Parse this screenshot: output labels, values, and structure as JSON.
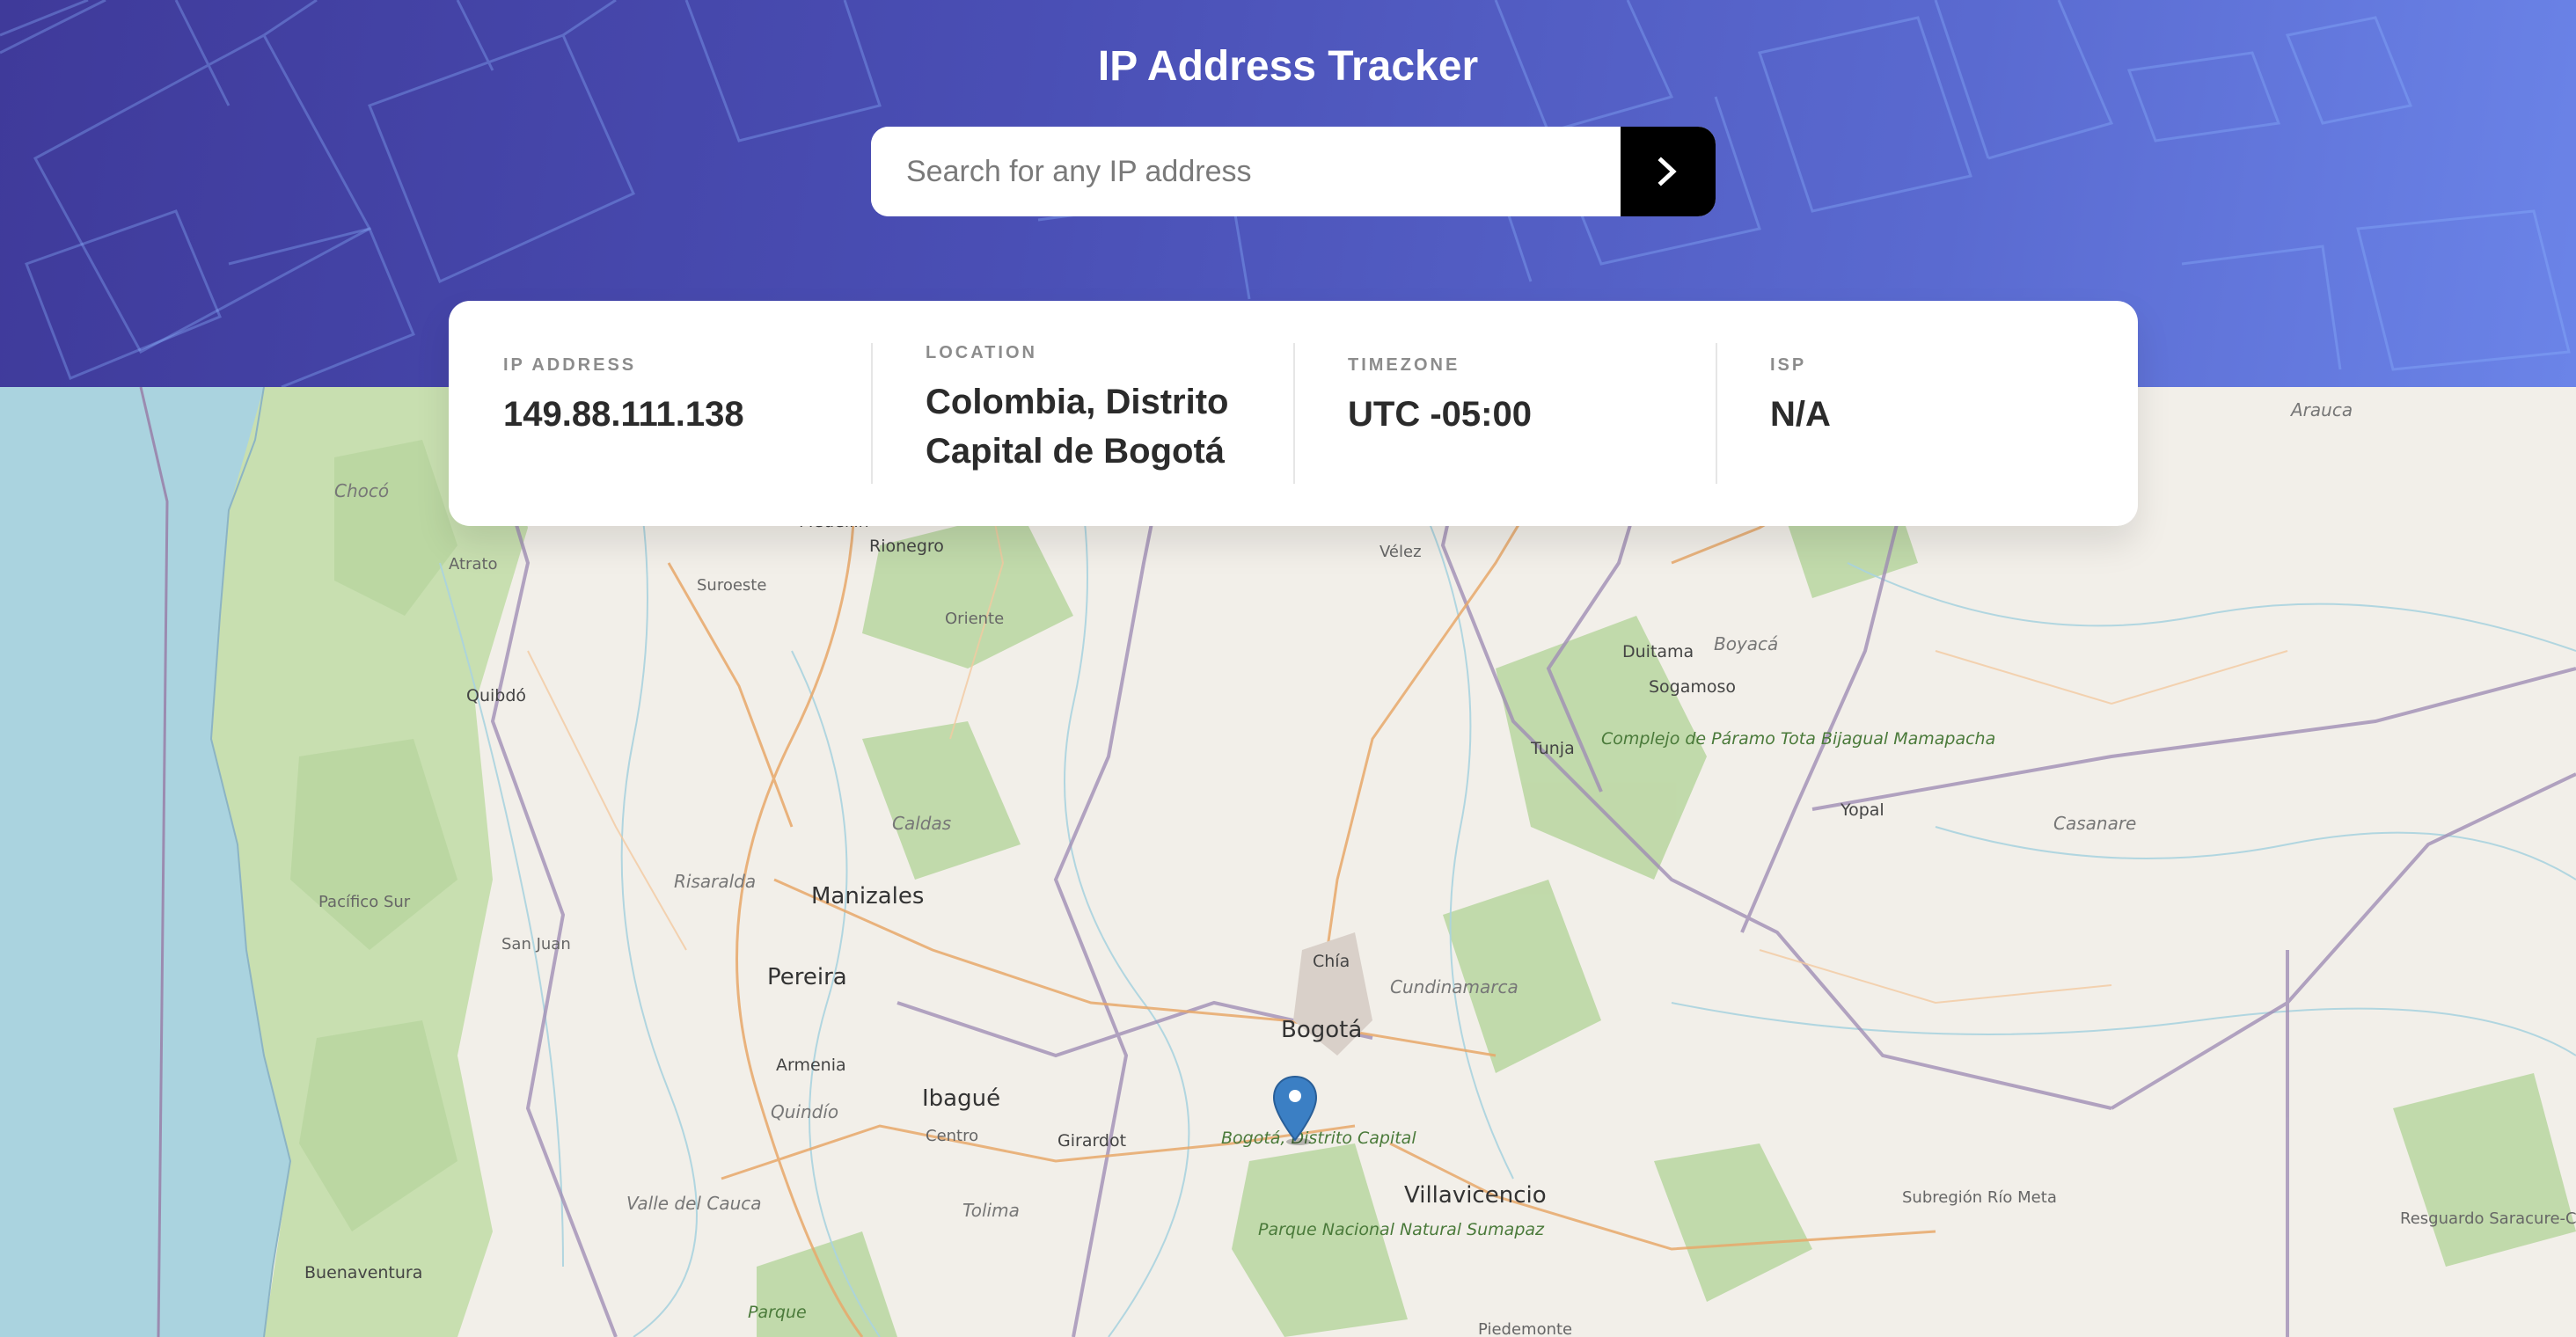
{
  "header": {
    "title": "IP Address Tracker",
    "search_placeholder": "Search for any IP address",
    "submit_icon": "chevron-right-icon"
  },
  "info": {
    "ip_label": "IP Address",
    "ip_value": "149.88.111.138",
    "location_label": "Location",
    "location_value": "Colombia, Distrito Capital de Bogotá",
    "timezone_label": "Timezone",
    "timezone_value": "UTC -05:00",
    "isp_label": "ISP",
    "isp_value": "N/A"
  },
  "map": {
    "marker_icon": "map-pin-icon",
    "labels": {
      "arauca": "Arauca",
      "choco": "Chocó",
      "medellin": "Medellín",
      "rionegro": "Rionegro",
      "velez": "Vélez",
      "atrato": "Atrato",
      "suroeste": "Suroeste",
      "oriente": "Oriente",
      "duitama": "Duitama",
      "boyaca": "Boyacá",
      "sogamoso": "Sogamoso",
      "quibdo": "Quibdó",
      "tunja": "Tunja",
      "complejo": "Complejo de Páramo Tota Bijagual Mamapacha",
      "yopal": "Yopal",
      "casanare": "Casanare",
      "caldas": "Caldas",
      "risaralda": "Risaralda",
      "manizales": "Manizales",
      "pacifico_sur": "Pacífico Sur",
      "san_juan": "San Juan",
      "chia": "Chía",
      "pereira": "Pereira",
      "cundinamarca": "Cundinamarca",
      "bogota": "Bogotá",
      "armenia": "Armenia",
      "ibague": "Ibagué",
      "quindio": "Quindío",
      "centro": "Centro",
      "girardot": "Girardot",
      "bogota_dc": "Bogotá, Distrito Capital",
      "villavicencio": "Villavicencio",
      "subregion": "Subregión Río Meta",
      "resguardo": "Resguardo Saracure-Cadá",
      "valle": "Valle del Cauca",
      "tolima": "Tolima",
      "parque_sumapaz": "Parque Nacional Natural Sumapaz",
      "buenaventura": "Buenaventura",
      "parque": "Parque",
      "piedemonte": "Piedemonte"
    }
  }
}
